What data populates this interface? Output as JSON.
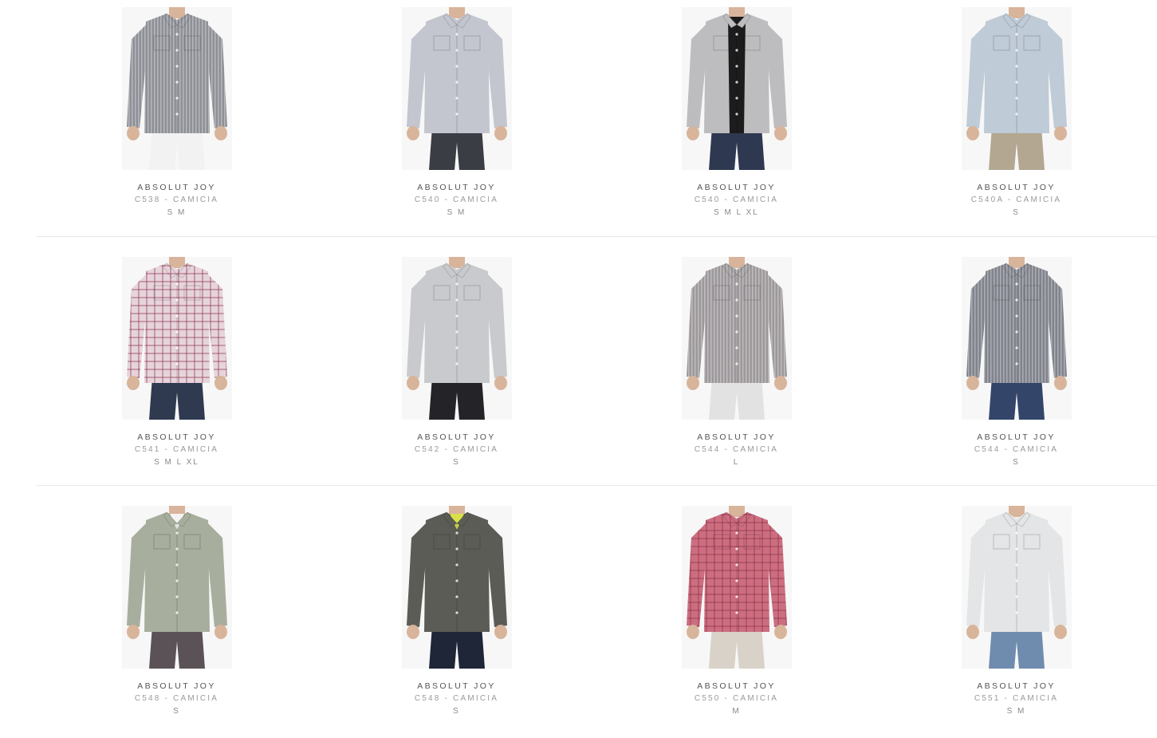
{
  "products": [
    {
      "brand": "ABSOLUT JOY",
      "model": "C538 - CAMICIA",
      "sizes": "S M",
      "shirt_color": "#8e9097",
      "pants_color": "#f2f2f2",
      "undershirt_color": "",
      "pattern": "stripes"
    },
    {
      "brand": "ABSOLUT JOY",
      "model": "C540 - CAMICIA",
      "sizes": "S M",
      "shirt_color": "#c3c6cf",
      "pants_color": "#3a3d44",
      "undershirt_color": "",
      "pattern": "plain"
    },
    {
      "brand": "ABSOLUT JOY",
      "model": "C540 - CAMICIA",
      "sizes": "S M L XL",
      "shirt_color": "#bdbdbf",
      "pants_color": "#2e3850",
      "undershirt_color": "#1c1c1c",
      "pattern": "open"
    },
    {
      "brand": "ABSOLUT JOY",
      "model": "C540A - CAMICIA",
      "sizes": "S",
      "shirt_color": "#bfcbd6",
      "pants_color": "#b3a791",
      "undershirt_color": "",
      "pattern": "plain"
    },
    {
      "brand": "ABSOLUT JOY",
      "model": "C541 - CAMICIA",
      "sizes": "S M L XL",
      "shirt_color": "#e6d4dc",
      "pants_color": "#2f3a50",
      "undershirt_color": "",
      "pattern": "check"
    },
    {
      "brand": "ABSOLUT JOY",
      "model": "C542 - CAMICIA",
      "sizes": "S",
      "shirt_color": "#c8cacd",
      "pants_color": "#242428",
      "undershirt_color": "",
      "pattern": "plain"
    },
    {
      "brand": "ABSOLUT JOY",
      "model": "C544 - CAMICIA",
      "sizes": "L",
      "shirt_color": "#9c989b",
      "pants_color": "#e2e2e2",
      "undershirt_color": "",
      "pattern": "stripes"
    },
    {
      "brand": "ABSOLUT JOY",
      "model": "C544 - CAMICIA",
      "sizes": "S",
      "shirt_color": "#80838c",
      "pants_color": "#34456a",
      "undershirt_color": "",
      "pattern": "stripes"
    },
    {
      "brand": "ABSOLUT JOY",
      "model": "C548 - CAMICIA",
      "sizes": "S",
      "shirt_color": "#a8ae9d",
      "pants_color": "#5b5257",
      "undershirt_color": "#f4f4f4",
      "pattern": "plain"
    },
    {
      "brand": "ABSOLUT JOY",
      "model": "C548 - CAMICIA",
      "sizes": "S",
      "shirt_color": "#5a5c55",
      "pants_color": "#1e2638",
      "undershirt_color": "#d8e04a",
      "pattern": "plain"
    },
    {
      "brand": "ABSOLUT JOY",
      "model": "C550 - CAMICIA",
      "sizes": "M",
      "shirt_color": "#cc6e80",
      "pants_color": "#d8d2c8",
      "undershirt_color": "",
      "pattern": "check"
    },
    {
      "brand": "ABSOLUT JOY",
      "model": "C551 - CAMICIA",
      "sizes": "S M",
      "shirt_color": "#e3e5e6",
      "pants_color": "#6f8cae",
      "undershirt_color": "",
      "pattern": "plain"
    }
  ]
}
